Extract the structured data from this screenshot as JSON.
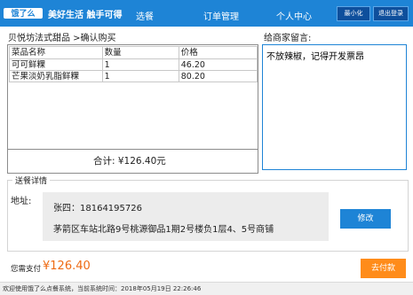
{
  "header": {
    "logo": "饿了么",
    "slogan": "美好生活 触手可得",
    "nav": [
      "选餐",
      "订单管理",
      "个人中心"
    ],
    "minimize_label": "最小化",
    "logout_label": "退出登录"
  },
  "order": {
    "breadcrumb": "贝悦坊法式甜品 >确认购买",
    "columns": [
      "菜品名称",
      "数量",
      "价格"
    ],
    "rows": [
      {
        "name": "可可鲜粿",
        "qty": "1",
        "price": "46.20"
      },
      {
        "name": "芒果淡奶乳脂鲜粿",
        "qty": "1",
        "price": "80.20"
      }
    ],
    "total": "合计:  ¥126.40元"
  },
  "message": {
    "label": "给商家留言:",
    "value": "不放辣椒，记得开发票昂"
  },
  "delivery": {
    "legend": "送餐详情",
    "address_label": "地址:",
    "contact": "张四：18164195726",
    "address": "茅箭区车站北路9号桃源御品1期2号楼负1层4、5号商铺",
    "edit_label": "修改"
  },
  "payment": {
    "label": "您需支付",
    "amount": "¥126.40",
    "pay_label": "去付款"
  },
  "status": {
    "text": "欢迎使用饿了么点餐系统，当前系统时间：2018年05月19日 22:26:46"
  },
  "colors": {
    "brand_blue": "#1e84d6",
    "pay_orange": "#ff8c1a",
    "amount_orange": "#ee6b14"
  }
}
